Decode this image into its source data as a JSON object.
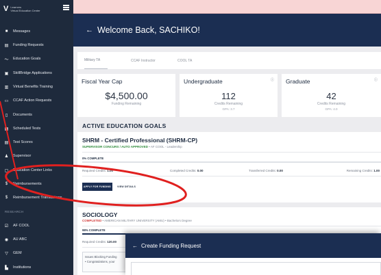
{
  "sidebar": {
    "logo_line1": "Learners",
    "logo_line2": "Virtual Education Center",
    "items": [
      {
        "icon": "message-icon",
        "glyph": "■",
        "label": "Messages"
      },
      {
        "icon": "funding-icon",
        "glyph": "▤",
        "label": "Funding Requests"
      },
      {
        "icon": "trend-icon",
        "glyph": "〜",
        "label": "Education Goals"
      },
      {
        "icon": "briefcase-icon",
        "glyph": "▣",
        "label": "SkillBridge Applications"
      },
      {
        "icon": "training-icon",
        "glyph": "▥",
        "label": "Virtual Benefits Training"
      },
      {
        "icon": "action-icon",
        "glyph": "▭",
        "label": "CCAF Action Requests"
      },
      {
        "icon": "document-icon",
        "glyph": "▯",
        "label": "Documents"
      },
      {
        "icon": "calendar-icon",
        "glyph": "▦",
        "label": "Scheduled Tests"
      },
      {
        "icon": "test-icon",
        "glyph": "▤",
        "label": "Test Scores"
      },
      {
        "icon": "supervisor-icon",
        "glyph": "♟",
        "label": "Supervisor"
      },
      {
        "icon": "center-icon",
        "glyph": "▢",
        "label": "Education Center Links"
      },
      {
        "icon": "dollar-icon",
        "glyph": "$",
        "label": "Reimbursements"
      },
      {
        "icon": "dollar-icon",
        "glyph": "$",
        "label": "Reimbursement Transactions"
      }
    ],
    "research_label": "RESEARCH",
    "research_items": [
      {
        "icon": "check-icon",
        "glyph": "☑",
        "label": "AF COOL"
      },
      {
        "icon": "eye-icon",
        "glyph": "◉",
        "label": "AU ABC"
      },
      {
        "icon": "filter-icon",
        "glyph": "▽",
        "label": "GEM"
      },
      {
        "icon": "institution-icon",
        "glyph": "▙",
        "label": "Institutions"
      }
    ]
  },
  "header": {
    "back_arrow": "←",
    "title": "Welcome Back, SACHIKO!"
  },
  "tabs": [
    "Military TA",
    "CCAF Instructor",
    "COOL TA"
  ],
  "cards": {
    "fiscal": {
      "title": "Fiscal Year Cap",
      "amount": "$4,500.00",
      "sub": "Funding Remaining"
    },
    "undergrad": {
      "title": "Undergraduate",
      "info": "ⓘ",
      "amount": "112",
      "sub": "Credits Remaining",
      "gpa": "GPA: 3.7"
    },
    "graduate": {
      "title": "Graduate",
      "info": "ⓘ",
      "amount": "42",
      "sub": "Credits Remaining",
      "gpa": "GPA: 4.0"
    }
  },
  "section_title": "ACTIVE EDUCATION GOALS",
  "goals": [
    {
      "title": "SHRM - Certified Professional (SHRM-CP)",
      "status": "SUPERVISOR CONCURS / AUTO APPROVED",
      "meta": " • AF COOL - Leadership",
      "status_color": "#2e8b3a",
      "progress_label": "0% COMPLETE",
      "progress": 0,
      "required_label": "Required Credits:",
      "required_value": "1.00",
      "completed_label": "Completed Credits:",
      "completed_value": "0.00",
      "transferred_label": "Transferred Credits:",
      "transferred_value": "0.00",
      "remaining_label": "Remaining Credits:",
      "remaining_value": "1.00",
      "apply_label": "APPLY FOR FUNDING",
      "details_label": "VIEW DETAILS"
    },
    {
      "title": "SOCIOLOGY",
      "status": "COMPLETED",
      "meta": " • AMERICAN MILITARY UNIVERSITY (AMU) • Bachelors Degree",
      "status_color": "#d23a3a",
      "progress_label": "98% COMPLETE",
      "progress": 0.98,
      "required_label": "Required Credits:",
      "required_value": "120.00",
      "blocking_title": "Issues Blocking Funding",
      "blocking_item": "• Congratulations, your"
    }
  ],
  "modal": {
    "back_arrow": "←",
    "title": "Create Funding Request"
  },
  "colors": {
    "sidebar_bg": "#1e2a3c",
    "header_bg": "#1b2e52",
    "annotation_red": "#e0201f"
  }
}
